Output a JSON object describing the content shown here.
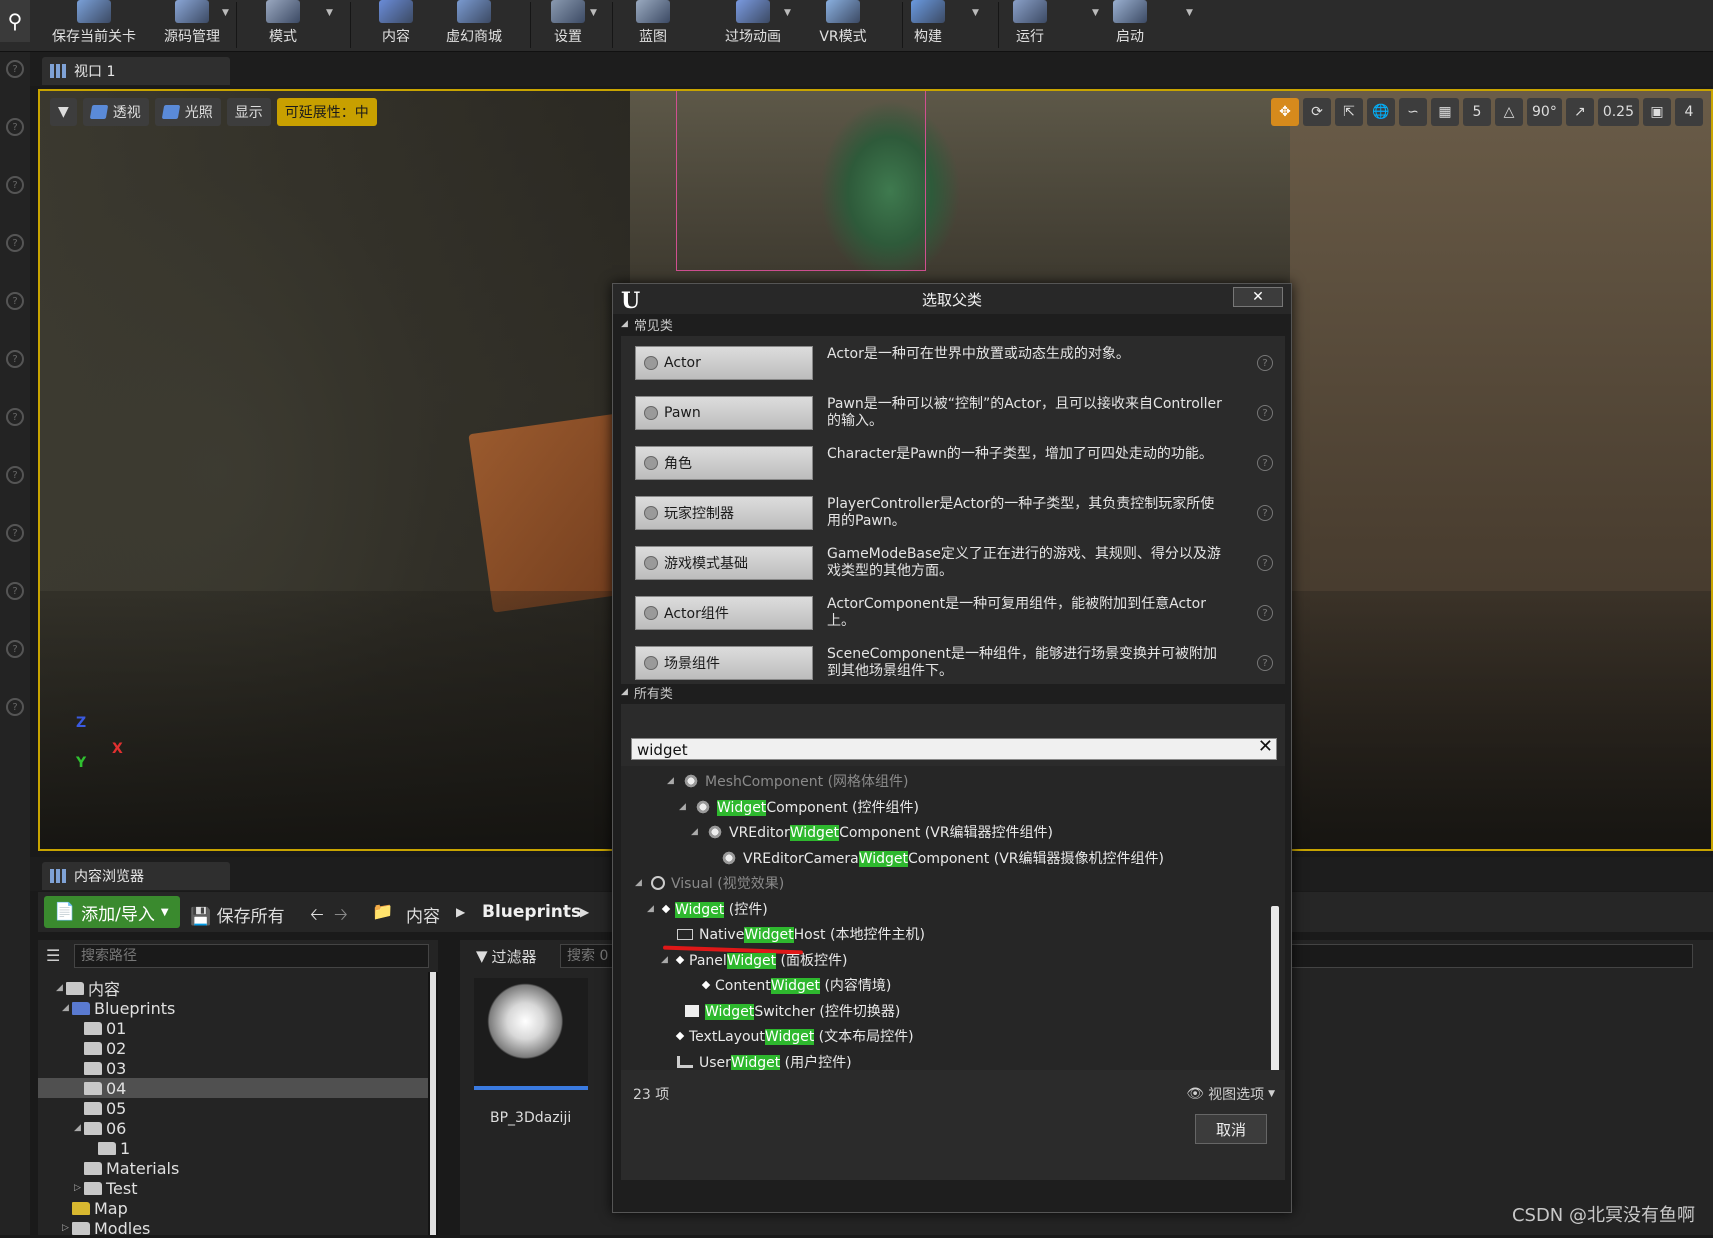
{
  "toolbar": {
    "items": [
      {
        "label": "保存当前关卡",
        "icon": "save-icon"
      },
      {
        "label": "源码管理",
        "icon": "source-control-icon"
      },
      {
        "label": "模式",
        "icon": "modes-icon"
      },
      {
        "label": "内容",
        "icon": "content-icon"
      },
      {
        "label": "虚幻商城",
        "icon": "marketplace-icon"
      },
      {
        "label": "设置",
        "icon": "settings-icon"
      },
      {
        "label": "蓝图",
        "icon": "blueprint-icon"
      },
      {
        "label": "过场动画",
        "icon": "cinematics-icon"
      },
      {
        "label": "VR模式",
        "icon": "vr-icon"
      },
      {
        "label": "构建",
        "icon": "build-icon"
      },
      {
        "label": "运行",
        "icon": "play-icon"
      },
      {
        "label": "启动",
        "icon": "launch-icon"
      }
    ]
  },
  "viewport": {
    "tab_label": "视口 1",
    "perspective_label": "透视",
    "lighting_label": "光照",
    "show_label": "显示",
    "scalability_label": "可延展性：中",
    "grid_snap_value": "5",
    "rotation_snap_value": "90°",
    "scale_snap_value": "0.25",
    "camera_speed_value": "4",
    "axis_x": "X",
    "axis_y": "Y",
    "axis_z": "Z"
  },
  "content_browser": {
    "tab_label": "内容浏览器",
    "add_import_label": "添加/导入",
    "save_all_label": "保存所有",
    "breadcrumb": [
      "内容",
      "Blueprints"
    ],
    "path_search_placeholder": "搜索路径",
    "filter_label": "过滤器",
    "asset_search_placeholder": "搜索 0",
    "tree": [
      {
        "label": "内容"
      },
      {
        "label": "Blueprints"
      },
      {
        "label": "01"
      },
      {
        "label": "02"
      },
      {
        "label": "03"
      },
      {
        "label": "04"
      },
      {
        "label": "05"
      },
      {
        "label": "06"
      },
      {
        "label": "1"
      },
      {
        "label": "Materials"
      },
      {
        "label": "Test"
      },
      {
        "label": "Map"
      },
      {
        "label": "Modles"
      }
    ],
    "asset_name": "BP_3Ddaziji"
  },
  "modal": {
    "title": "选取父类",
    "common_header": "常见类",
    "common_classes": [
      {
        "name": "Actor",
        "desc": "Actor是一种可在世界中放置或动态生成的对象。"
      },
      {
        "name": "Pawn",
        "desc": "Pawn是一种可以被“控制”的Actor，且可以接收来自Controller的输入。"
      },
      {
        "name": "角色",
        "desc": "Character是Pawn的一种子类型，增加了可四处走动的功能。"
      },
      {
        "name": "玩家控制器",
        "desc": "PlayerController是Actor的一种子类型，其负责控制玩家所使用的Pawn。"
      },
      {
        "name": "游戏模式基础",
        "desc": "GameModeBase定义了正在进行的游戏、其规则、得分以及游戏类型的其他方面。"
      },
      {
        "name": "Actor组件",
        "desc": "ActorComponent是一种可复用组件，能被附加到任意Actor上。"
      },
      {
        "name": "场景组件",
        "desc": "SceneComponent是一种组件，能够进行场景变换并可被附加到其他场景组件下。"
      }
    ],
    "all_header": "所有类",
    "search_value": "widget",
    "list": [
      {
        "pre": "",
        "hl": "",
        "post": "MeshComponent (网格体组件)",
        "dim": true
      },
      {
        "pre": "",
        "hl": "Widget",
        "post": "Component (控件组件)"
      },
      {
        "pre": "VREditor",
        "hl": "Widget",
        "post": "Component (VR编辑器控件组件)"
      },
      {
        "pre": "VREditorCamera",
        "hl": "Widget",
        "post": "Component (VR编辑器摄像机控件组件)"
      },
      {
        "pre": "",
        "hl": "",
        "post": "Visual (视觉效果)",
        "dim": true
      },
      {
        "pre": "",
        "hl": "Widget",
        "post": " (控件)"
      },
      {
        "pre": "Native",
        "hl": "Widget",
        "post": "Host (本地控件主机)"
      },
      {
        "pre": "Panel",
        "hl": "Widget",
        "post": " (面板控件)"
      },
      {
        "pre": "Content",
        "hl": "Widget",
        "post": " (内容情境)"
      },
      {
        "pre": "",
        "hl": "Widget",
        "post": "Switcher (控件切换器)"
      },
      {
        "pre": "TextLayout",
        "hl": "Widget",
        "post": " (文本布局控件)"
      },
      {
        "pre": "User",
        "hl": "Widget",
        "post": " (用户控件)"
      }
    ],
    "count_label": "23 项",
    "view_options_label": "视图选项",
    "cancel_label": "取消"
  },
  "watermark": "CSDN @北冥没有鱼啊"
}
